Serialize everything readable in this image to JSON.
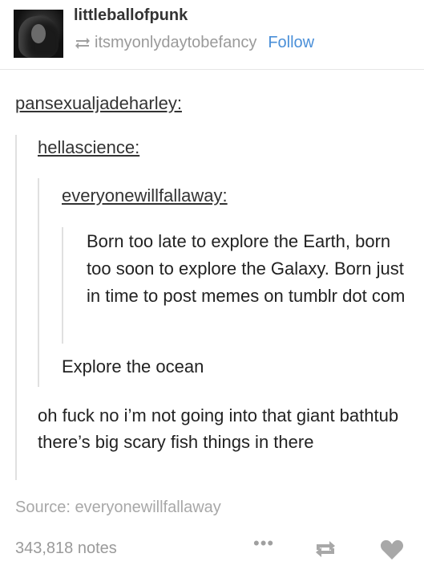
{
  "post": {
    "author": "littleballofpunk",
    "reblogged_from": "itsmyonlydaytobefancy",
    "follow_label": "Follow",
    "thread": [
      {
        "user": "pansexualjadeharley:"
      },
      {
        "user": "hellascience:"
      },
      {
        "user": "everyonewillfallaway:"
      }
    ],
    "original_text": "Born too late to explore the Earth, born too soon to explore the Galaxy. Born just in time to post memes on tumblr dot com",
    "reply_ocean": "Explore the ocean",
    "reply_final": "oh fuck no i’m not going into that giant bathtub there’s big scary fish things in there",
    "source": "Source: everyonewillfallaway",
    "notes": "343,818 notes",
    "more_label": "•••"
  },
  "icons": {
    "reblog": "reblog-icon",
    "heart": "heart-icon",
    "more": "more-icon"
  },
  "colors": {
    "link": "#4a8fd8",
    "muted": "#9a9a9a"
  }
}
